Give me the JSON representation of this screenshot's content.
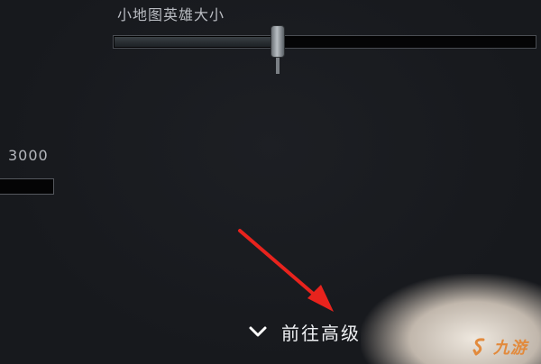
{
  "settings": {
    "minimap_hero_size": {
      "label": "小地图英雄大小",
      "value_fraction": 0.39
    },
    "left_field": {
      "value_label": "3000"
    },
    "advanced_link": {
      "label": "前往高级",
      "icon": "chevron-down-icon"
    }
  },
  "annotation": {
    "arrow_color": "#e8231d"
  },
  "watermark": {
    "text": "九游",
    "color": "#e28a3c"
  }
}
